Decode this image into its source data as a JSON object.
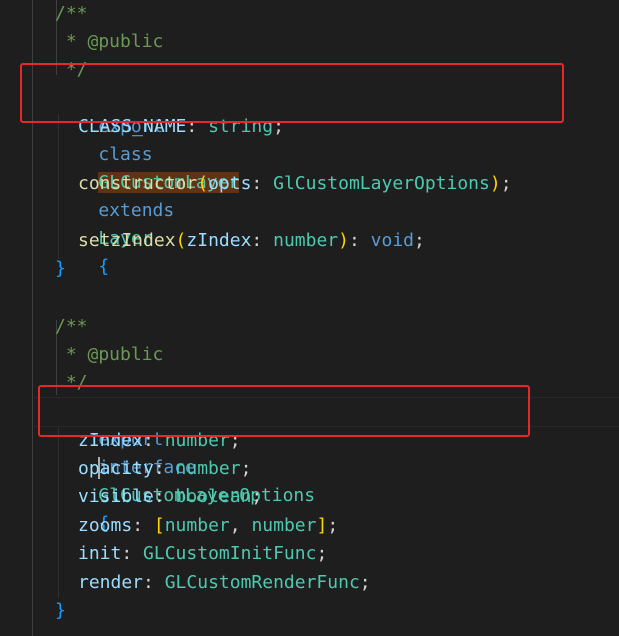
{
  "editor": {
    "colors": {
      "background": "#1e1e1e",
      "keyword": "#569cd6",
      "type": "#4ec9b0",
      "property": "#9cdcfe",
      "function": "#dcdcaa",
      "comment": "#6a9955",
      "annotation_box": "#e5292b",
      "highlight": "#613214"
    },
    "block1": {
      "doc_open": "/**",
      "doc_tag": " * @public",
      "doc_close": " */",
      "kw_export": "export",
      "kw_class": "class",
      "class_name": "GLCustomLayer",
      "kw_extends": "extends",
      "base_class": "Layer",
      "brace_open": "{",
      "member1_name": "CLASS_NAME",
      "member1_colon": ": ",
      "member1_type": "string",
      "member1_semi": ";",
      "ctor_name": "constructor",
      "ctor_paren_open": "(",
      "ctor_param": "opts",
      "ctor_colon": ": ",
      "ctor_type": "GlCustomLayerOptions",
      "ctor_paren_close": ")",
      "ctor_semi": ";",
      "method_name": "setzIndex",
      "method_paren_open": "(",
      "method_param": "zIndex",
      "method_colon": ": ",
      "method_type": "number",
      "method_paren_close": ")",
      "method_ret_colon": ": ",
      "method_ret": "void",
      "method_semi": ";",
      "brace_close": "}"
    },
    "block2": {
      "doc_open": "/**",
      "doc_tag": " * @public",
      "doc_close": " */",
      "kw_export": "export",
      "kw_interface": "interface",
      "iface_name": "GlCustomLayerOptions",
      "brace_open": "{",
      "fields": [
        {
          "name": "zIndex",
          "colon": ": ",
          "type": "number",
          "semi": ";"
        },
        {
          "name": "opacity",
          "colon": ": ",
          "type": "number",
          "semi": ";"
        },
        {
          "name": "visible",
          "colon": ": ",
          "type": "boolean",
          "semi": ";"
        }
      ],
      "zooms_name": "zooms",
      "zooms_colon": ": ",
      "zooms_lb": "[",
      "zooms_t1": "number",
      "zooms_comma": ", ",
      "zooms_t2": "number",
      "zooms_rb": "]",
      "zooms_semi": ";",
      "init_name": "init",
      "init_colon": ": ",
      "init_type": "GLCustomInitFunc",
      "init_semi": ";",
      "render_name": "render",
      "render_colon": ": ",
      "render_type": "GLCustomRenderFunc",
      "render_semi": ";",
      "brace_close": "}"
    }
  }
}
